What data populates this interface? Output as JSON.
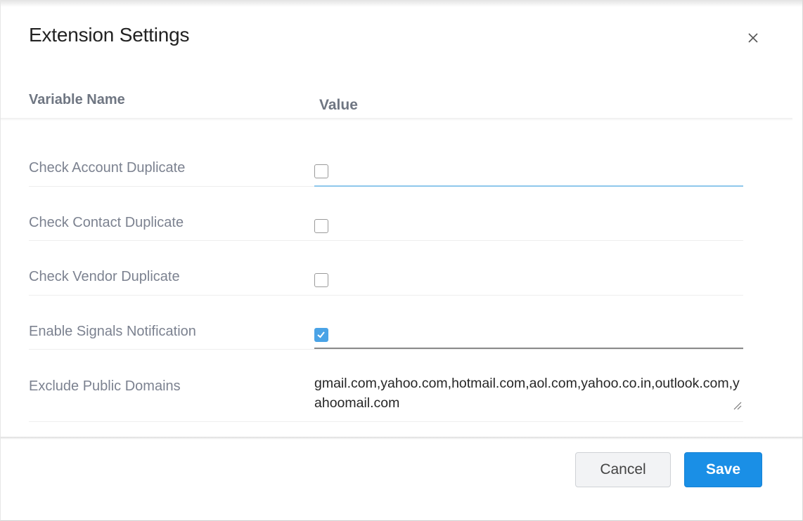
{
  "dialog": {
    "title": "Extension Settings",
    "close_icon": "close-icon"
  },
  "table": {
    "headers": {
      "name": "Variable Name",
      "value": "Value"
    },
    "rows": [
      {
        "label": "Check Account Duplicate",
        "type": "checkbox",
        "checked": false,
        "focused": true
      },
      {
        "label": "Check Contact Duplicate",
        "type": "checkbox",
        "checked": false
      },
      {
        "label": "Check Vendor Duplicate",
        "type": "checkbox",
        "checked": false
      },
      {
        "label": "Enable Signals Notification",
        "type": "checkbox",
        "checked": true
      },
      {
        "label": "Exclude Public Domains",
        "type": "textarea",
        "value": "gmail.com,yahoo.com,hotmail.com,aol.com,yahoo.co.in,outlook.com,yahoomail.com"
      }
    ]
  },
  "footer": {
    "cancel_label": "Cancel",
    "save_label": "Save"
  },
  "colors": {
    "accent": "#1a8fe6",
    "checkbox_checked": "#4aa3e6",
    "label_text": "#7c8290"
  }
}
